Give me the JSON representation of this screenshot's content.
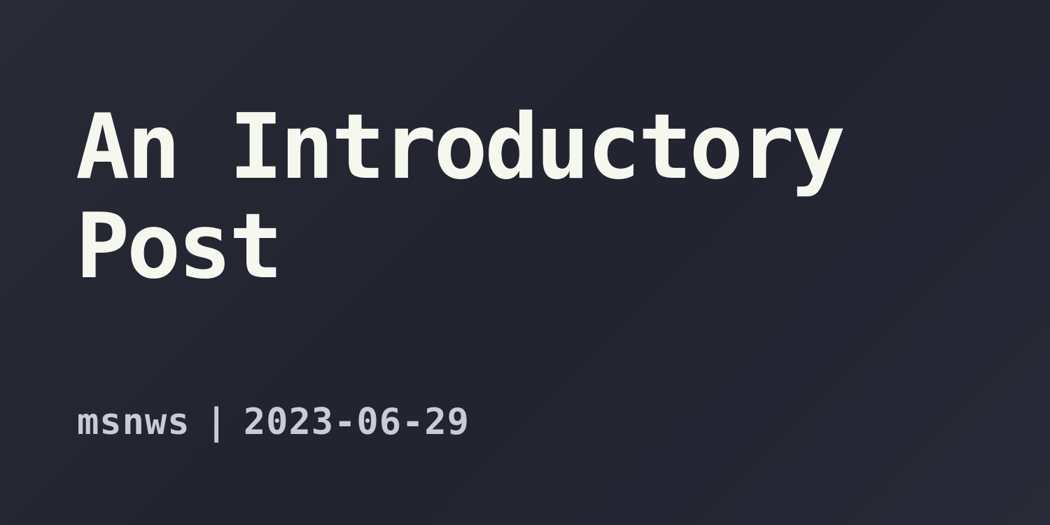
{
  "post": {
    "title": "An Introductory Post",
    "author": "msnws",
    "separator": "|",
    "date": "2023-06-29"
  },
  "colors": {
    "background": "#24262f",
    "title_text": "#f6f7ef",
    "meta_text": "#c7ccd8"
  }
}
